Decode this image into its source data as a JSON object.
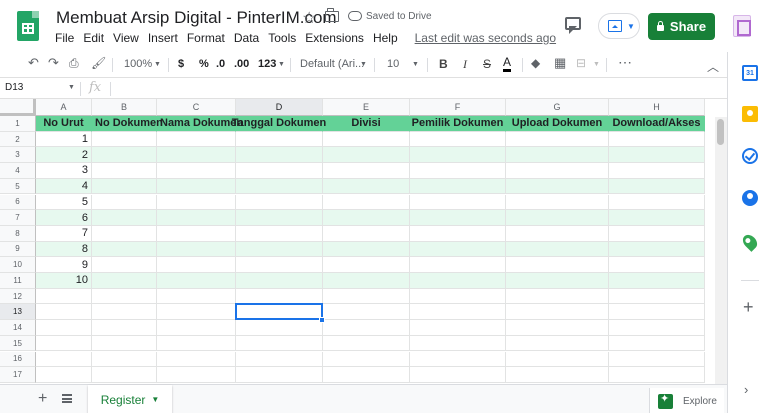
{
  "header": {
    "doc_title": "Membuat Arsip Digital - PinterIM.com",
    "save_status": "Saved to Drive",
    "share_label": "Share",
    "last_edit": "Last edit was seconds ago"
  },
  "menu": [
    "File",
    "Edit",
    "View",
    "Insert",
    "Format",
    "Data",
    "Tools",
    "Extensions",
    "Help"
  ],
  "toolbar": {
    "zoom": "100%",
    "currency": "$",
    "percent": "%",
    "decimal_decrease": ".0",
    "decimal_increase": ".00",
    "more_formats": "123",
    "font": "Default (Ari...",
    "font_size": "10",
    "bold": "B",
    "italic": "I",
    "strikethrough": "S",
    "text_color": "A",
    "more": "⋯"
  },
  "formula_bar": {
    "name_box": "D13",
    "fx": "fx",
    "value": ""
  },
  "sheet": {
    "columns": [
      "A",
      "B",
      "C",
      "D",
      "E",
      "F",
      "G",
      "H"
    ],
    "selected_column": "D",
    "selected_row": "13",
    "row_numbers": [
      "1",
      "2",
      "3",
      "4",
      "5",
      "6",
      "7",
      "8",
      "9",
      "10",
      "11",
      "12",
      "13",
      "14",
      "15",
      "16",
      "17"
    ],
    "header_row": [
      "No Urut",
      "No Dokumen",
      "Nama Dokumen",
      "Tanggal Dokumen",
      "Divisi",
      "Pemilik Dokumen",
      "Upload Dokumen",
      "Download/Akses"
    ],
    "data_rows": [
      "1",
      "2",
      "3",
      "4",
      "5",
      "6",
      "7",
      "8",
      "9",
      "10"
    ],
    "header_fill": "#63d297",
    "band_fill": "#e7f9ef"
  },
  "sheet_tabs": {
    "active": "Register",
    "explore_label": "Explore"
  },
  "side_panel": {
    "calendar_day": "31"
  }
}
